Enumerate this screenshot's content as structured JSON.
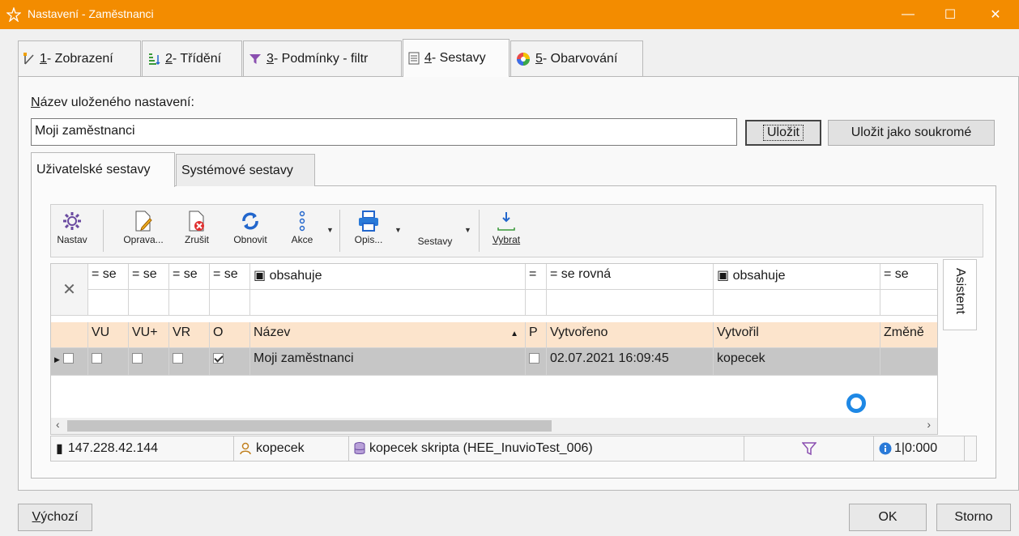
{
  "window": {
    "title": "Nastavení - Zaměstnanci",
    "minimize": "—",
    "maximize": "☐",
    "close": "✕"
  },
  "tabs": [
    {
      "key": "1",
      "label": " - Zobrazení"
    },
    {
      "key": "2",
      "label": " - Třídění"
    },
    {
      "key": "3",
      "label": " - Podmínky - filtr"
    },
    {
      "key": "4",
      "label": " - Sestavy"
    },
    {
      "key": "5",
      "label": " - Obarvování"
    }
  ],
  "form": {
    "name_label_first": "N",
    "name_label_rest": "ázev uloženého nastavení:",
    "name_value": "Moji zaměstnanci",
    "save_label": "Uložit",
    "save_private_label": "Uložit jako soukromé"
  },
  "subtabs": {
    "user": "Uživatelské sestavy",
    "system": "Systémové sestavy"
  },
  "toolbar": {
    "nastav": "Nastav",
    "oprava": "Oprava...",
    "zrusit": "Zrušit",
    "obnovit": "Obnovit",
    "akce": "Akce",
    "opis": "Opis...",
    "sestavy": "Sestavy",
    "vybrat": "Vybrat"
  },
  "filter": {
    "clear_icon": "✕",
    "c1": "= se",
    "c2": "= se",
    "c3": "= se",
    "c4": "= se",
    "c5": "obsahuje",
    "c6": "=",
    "c7": "= se rovná",
    "c8": "obsahuje",
    "c9": "= se"
  },
  "headers": {
    "vu": "VU",
    "vuplus": "VU+",
    "vr": "VR",
    "o": "O",
    "nazev": "Název",
    "p": "P",
    "vytvoreno": "Vytvořeno",
    "vytvoril": "Vytvořil",
    "zmeneno": "Změně"
  },
  "rows": [
    {
      "vu": false,
      "vuplus": false,
      "vr": false,
      "o": true,
      "nazev": "Moji zaměstnanci",
      "p": false,
      "vytvoreno": "02.07.2021 16:09:45",
      "vytvoril": "kopecek"
    }
  ],
  "side": {
    "asistent": "Asistent"
  },
  "status": {
    "ip": "147.228.42.144",
    "user": "kopecek",
    "db": "kopecek skripta (HEE_InuvioTest_006)",
    "count": "1|0:000"
  },
  "footer": {
    "default_first": "V",
    "default_rest": "ýchozí",
    "ok": "OK",
    "storno": "Storno"
  },
  "colors": {
    "accent": "#f38c00",
    "header": "#fce4cc",
    "selected": "#c6c6c6"
  }
}
